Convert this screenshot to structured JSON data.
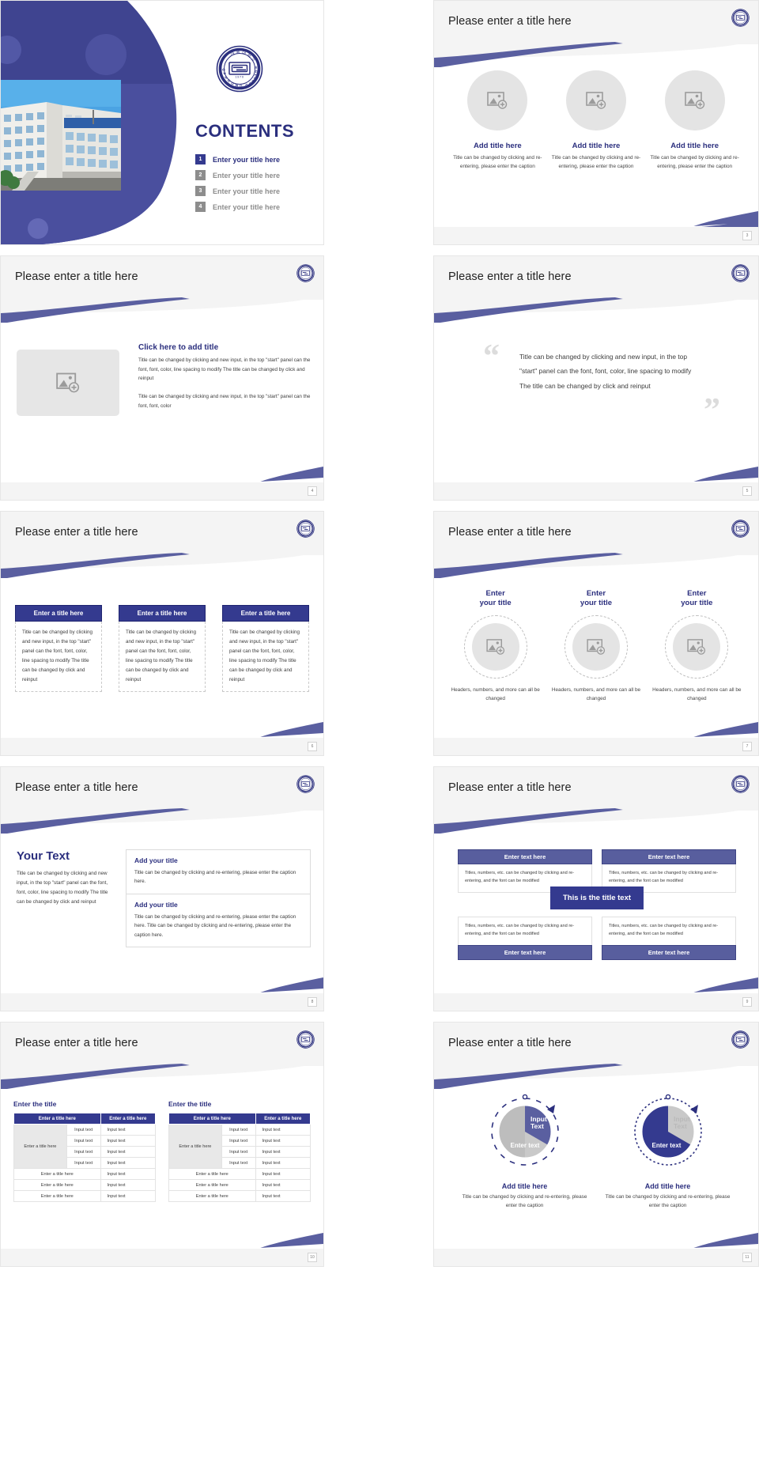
{
  "brand": {
    "primary": "#2b2f7e",
    "accent": "#343a8f",
    "accent_light": "#585e9e",
    "grey": "#8d8d8d",
    "logo_top": "대동대학교",
    "logo_bottom": "DAEDONG COLLEGE",
    "logo_year": "1970"
  },
  "common": {
    "slide_title": "Please enter a title here"
  },
  "slide1": {
    "contents_title": "CONTENTS",
    "toc": [
      {
        "num": "1",
        "label": "Enter your title here",
        "active": true
      },
      {
        "num": "2",
        "label": "Enter your title here",
        "active": false
      },
      {
        "num": "3",
        "label": "Enter your title here",
        "active": false
      },
      {
        "num": "4",
        "label": "Enter your title here",
        "active": false
      }
    ]
  },
  "slide2": {
    "page": "3",
    "columns": [
      {
        "title": "Add title here",
        "body": "Title can be changed by clicking and re-entering, please enter the caption"
      },
      {
        "title": "Add title here",
        "body": "Title can be changed by clicking and re-entering, please enter the caption"
      },
      {
        "title": "Add title here",
        "body": "Title can be changed by clicking and re-entering, please enter the caption"
      }
    ]
  },
  "slide3": {
    "page": "4",
    "heading": "Click here to add title",
    "para1": "Title can be changed by clicking and new input, in the top \"start\" panel can the font, font, color, line spacing to modify The title can be changed by click and reinput",
    "para2": "Title can be changed by clicking and new input, in the top \"start\" panel can the font, font, color"
  },
  "slide4": {
    "page": "5",
    "quote_open": "“",
    "quote_close": "”",
    "quote": "Title can be changed by clicking and new input, in the top \"start\" panel can the font, font, color, line spacing to modify The title can be changed by click and reinput"
  },
  "slide5": {
    "page": "6",
    "cards": [
      {
        "title": "Enter a title here",
        "body": "Title can be changed by clicking and new input, in the top \"start\" panel can the font, font, color, line spacing to modify The title can be changed by click and reinput"
      },
      {
        "title": "Enter a title here",
        "body": "Title can be changed by clicking and new input, in the top \"start\" panel can the font, font, color, line spacing to modify The title can be changed by click and reinput"
      },
      {
        "title": "Enter a title here",
        "body": "Title can be changed by clicking and new input, in the top \"start\" panel can the font, font, color, line spacing to modify The title can be changed by click and reinput"
      }
    ]
  },
  "slide6": {
    "page": "7",
    "rings": [
      {
        "title": "Enter\nyour title",
        "caption": "Headers, numbers, and more can all be changed"
      },
      {
        "title": "Enter\nyour title",
        "caption": "Headers, numbers, and more can all be changed"
      },
      {
        "title": "Enter\nyour title",
        "caption": "Headers, numbers, and more can all be changed"
      }
    ]
  },
  "slide7": {
    "page": "8",
    "heading": "Your Text",
    "body": "Title can be changed by clicking and new input, in the top \"start\" panel can the font, font, color, line spacing to modify The title can be changed by click and reinput",
    "boxes": [
      {
        "title": "Add your title",
        "body": "Title can be changed by clicking and re-entering, please enter the caption here."
      },
      {
        "title": "Add your title",
        "body": "Title can be changed by clicking and re-entering, please enter the caption here. Title can be changed by clicking and re-entering, please enter the caption here."
      }
    ]
  },
  "slide8": {
    "page": "9",
    "center_badge": "This is the title text",
    "top_headers": [
      "Enter text here",
      "Enter text here"
    ],
    "top_bodies": [
      "Titles, numbers, etc. can be changed by clicking and re-entering, and the font can be modified",
      "Titles, numbers, etc. can be changed by clicking and re-entering, and the font can be modified"
    ],
    "bottom_bodies": [
      "Titles, numbers, etc. can be changed by clicking and re-entering, and the font can be modified",
      "Titles, numbers, etc. can be changed by clicking and re-entering, and the font can be modified"
    ],
    "bottom_headers": [
      "Enter text here",
      "Enter text here"
    ]
  },
  "slide9": {
    "page": "10",
    "tables": [
      {
        "caption": "Enter the title",
        "headers": [
          "Enter a title here",
          "Enter a title here"
        ],
        "merged_label": "Enter a title here",
        "merged_rows": [
          "Input text",
          "Input text",
          "Input text",
          "Input text"
        ],
        "merged_vals": [
          "Input text",
          "Input text",
          "Input text",
          "Input text"
        ],
        "tail_rows": [
          [
            "Enter a title here",
            "Input text"
          ],
          [
            "Enter a title here",
            "Input text"
          ],
          [
            "Enter a title here",
            "Input text"
          ]
        ]
      },
      {
        "caption": "Enter the title",
        "headers": [
          "Enter a title here",
          "Enter a title here"
        ],
        "merged_label": "Enter a title here",
        "merged_rows": [
          "Input text",
          "Input text",
          "Input text",
          "Input text"
        ],
        "merged_vals": [
          "Input text",
          "Input text",
          "Input text",
          "Input text"
        ],
        "tail_rows": [
          [
            "Enter a title here",
            "Input text"
          ],
          [
            "Enter a title here",
            "Input text"
          ],
          [
            "Enter a title here",
            "Input text"
          ]
        ]
      }
    ]
  },
  "slide10": {
    "page": "11",
    "donuts": [
      {
        "inner_label": "Input\nText",
        "arc_label": "Enter text",
        "title": "Add title here",
        "caption": "Title can be changed by clicking and re-entering, please enter the caption",
        "grey_pct": 70,
        "accent_pct": 30
      },
      {
        "inner_label": "Input\nText",
        "arc_label": "Enter text",
        "title": "Add title here",
        "caption": "Title can be changed by clicking and re-entering, please enter the caption",
        "grey_pct": 35,
        "accent_pct": 65
      }
    ]
  }
}
